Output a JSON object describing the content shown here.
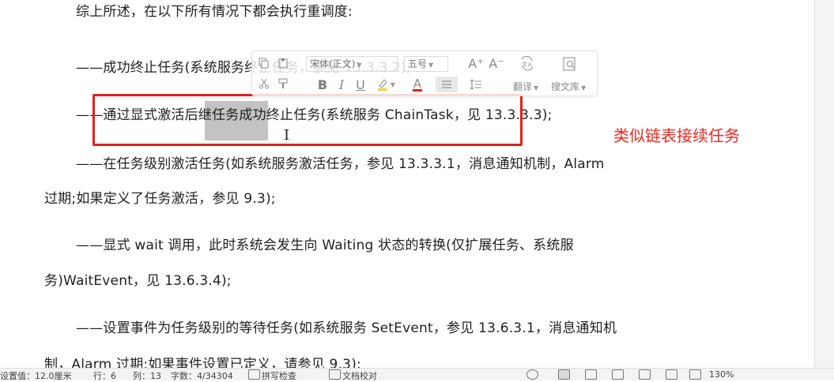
{
  "document": {
    "lines": [
      "综上所述，在以下所有情况下都会执行重调度:",
      "——成功终止任务(系统服务终止任务，参见 13.3.3.2);",
      "——通过显式激活后继任务成功终止任务(系统服务 ChainTask，见 13.3.3.3);",
      "——在任务级别激活任务(如系统服务激活任务，参见 13.3.3.1，消息通知机制，Alarm",
      "过期;如果定义了任务激活，参见 9.3);",
      "——显式 wait 调用，此时系统会发生向 Waiting 状态的转换(仅扩展任务、系统服",
      "务)WaitEvent，见 13.6.3.4);",
      "——设置事件为任务级别的等待任务(如系统服务 SetEvent，参见 13.6.3.1，消息通知机",
      "制，Alarm 过期;如果事件设置已定义，请参见 9.3);"
    ],
    "annotation": "类似链表接续任务",
    "annotation_color": "#f0261c",
    "highlight_box_color": "#e0231b"
  },
  "mini_toolbar": {
    "font_name": "宋体(正文)",
    "font_size": "五号",
    "increase_font_label": "A⁺",
    "decrease_font_label": "A⁻",
    "bold": "B",
    "italic": "I",
    "underline": "U",
    "font_color_label": "A",
    "translate_label": "翻译",
    "search_library_label": "搜文库"
  },
  "status_bar": {
    "left_text": "设置值：12.0厘米",
    "line": "行：6",
    "column": "列：13",
    "word_count": "字数：4/34304",
    "spell_check": "拼写检查",
    "doc_check": "文档校对",
    "zoom": "130%"
  }
}
